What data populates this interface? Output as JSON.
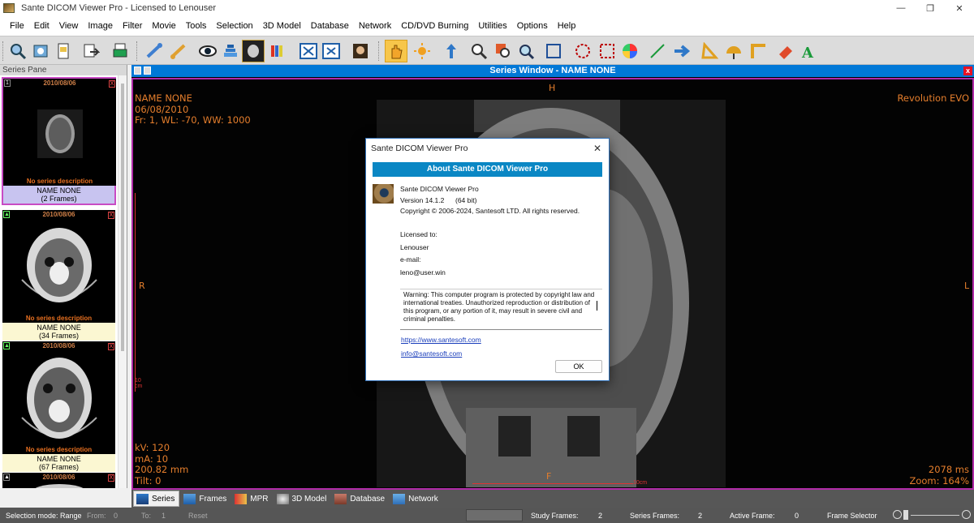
{
  "window": {
    "title": "Sante DICOM Viewer Pro - Licensed to Lenouser",
    "min": "—",
    "max": "❐",
    "close": "✕"
  },
  "menu": [
    "File",
    "Edit",
    "View",
    "Image",
    "Filter",
    "Movie",
    "Tools",
    "Selection",
    "3D Model",
    "Database",
    "Network",
    "CD/DVD Burning",
    "Utilities",
    "Options",
    "Help"
  ],
  "series_pane": {
    "title": "Series Pane",
    "items": [
      {
        "date": "2010/08/06",
        "num": "1",
        "close": "X",
        "desc": "No series description",
        "name": "NAME NONE",
        "frames": "(2 Frames)"
      },
      {
        "date": "2010/08/06",
        "num": "▲",
        "close": "X",
        "desc": "No series description",
        "name": "NAME NONE",
        "frames": "(34 Frames)"
      },
      {
        "date": "2010/08/06",
        "num": "▲",
        "close": "X",
        "desc": "No series description",
        "name": "NAME NONE",
        "frames": "(67 Frames)"
      },
      {
        "date": "2010/08/06",
        "num": "▲",
        "close": "X"
      }
    ]
  },
  "series_window": {
    "title": "Series Window - NAME NONE",
    "close": "x",
    "overlay": {
      "top": "H",
      "left": "R",
      "right": "L",
      "bottom": "F",
      "name": "NAME NONE",
      "date": "06/08/2010",
      "frame_info": "Fr: 1, WL: -70, WW: 1000",
      "device": "Revolution EVO",
      "kv": "kV: 120",
      "ma": "mA: 10",
      "distance": "200.82 mm",
      "tilt": "Tilt: 0",
      "time": "2078 ms",
      "zoom": "Zoom: 164%",
      "scale_v": "10 cm",
      "scale_h": "10cm"
    }
  },
  "dialog": {
    "title": "Sante DICOM Viewer Pro",
    "close": "✕",
    "banner": "About Sante DICOM Viewer Pro",
    "product": "Sante DICOM Viewer Pro",
    "version": "Version 14.1.2",
    "bits": "(64 bit)",
    "copyright": "Copyright © 2006-2024, Santesoft LTD. All rights reserved.",
    "licensed_to_label": "Licensed to:",
    "licensee": "Lenouser",
    "email_label": "e-mail:",
    "email": "leno@user.win",
    "warning": "Warning: This computer program is protected by copyright law and international treaties. Unauthorized reproduction or distribution of this program, or any portion of it, may result in severe civil and criminal penalties.",
    "website": "https://www.santesoft.com",
    "contact": "info@santesoft.com",
    "ok": "OK"
  },
  "tabs": [
    "Series",
    "Frames",
    "MPR",
    "3D Model",
    "Database",
    "Network"
  ],
  "status": {
    "mode": "Selection mode: Range",
    "from_label": "From:",
    "from": "0",
    "to_label": "To:",
    "to": "1",
    "reset": "Reset",
    "study_frames_label": "Study Frames:",
    "study_frames": "2",
    "series_frames_label": "Series Frames:",
    "series_frames": "2",
    "active_frame_label": "Active Frame:",
    "active_frame": "0",
    "frame_selector": "Frame Selector"
  },
  "colors": {
    "accent": "#0078d7",
    "overlay_text": "#e57e2c",
    "viewport_border": "#b02ba8",
    "banner": "#0a87c4"
  }
}
